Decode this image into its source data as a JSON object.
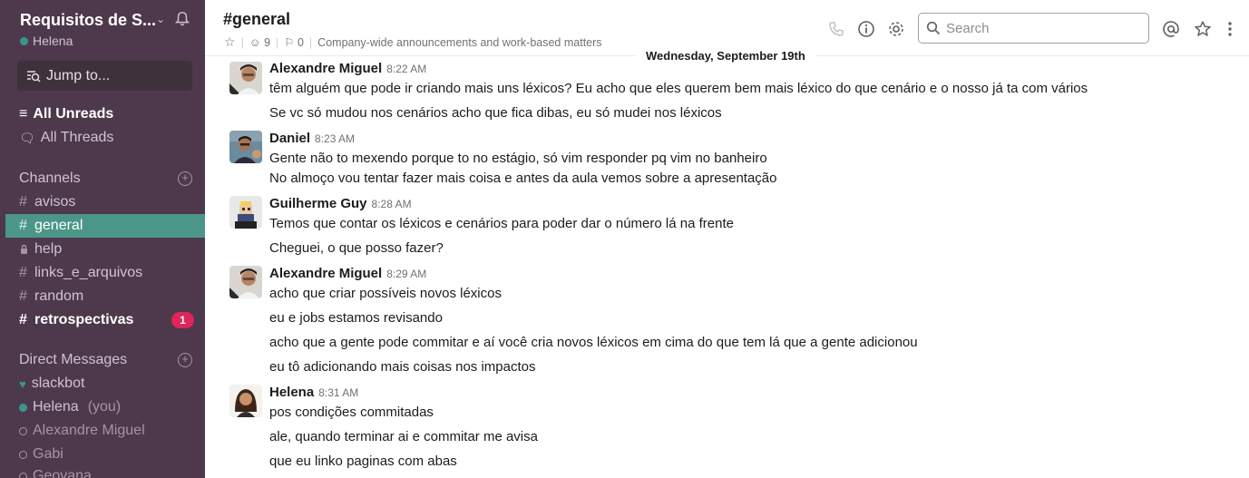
{
  "sidebar": {
    "workspace_name": "Requisitos de S...",
    "user_name": "Helena",
    "jump_to": "Jump to...",
    "all_unreads": "All Unreads",
    "all_threads": "All Threads",
    "channels_header": "Channels",
    "channels": [
      {
        "name": "avisos"
      },
      {
        "name": "general"
      },
      {
        "name": "help"
      },
      {
        "name": "links_e_arquivos"
      },
      {
        "name": "random"
      },
      {
        "name": "retrospectivas",
        "badge": "1"
      }
    ],
    "dm_header": "Direct Messages",
    "dms": [
      {
        "name": "slackbot"
      },
      {
        "name": "Helena",
        "suffix": "(you)"
      },
      {
        "name": "Alexandre Miguel"
      },
      {
        "name": "Gabi"
      },
      {
        "name": "Geovana"
      }
    ]
  },
  "header": {
    "channel_title": "#general",
    "members_count": "9",
    "pinned_count": "0",
    "topic": "Company-wide announcements and work-based matters",
    "search_placeholder": "Search"
  },
  "date_divider": "Wednesday, September 19th",
  "messages": [
    {
      "author": "Alexandre Miguel",
      "time": "8:22 AM",
      "lines": [
        "têm alguém que pode ir criando mais uns léxicos? Eu acho que eles querem bem mais léxico do que cenário e o nosso já ta com vários",
        "Se vc só mudou nos cenários acho que fica dibas, eu só mudei nos léxicos"
      ]
    },
    {
      "author": "Daniel",
      "time": "8:23 AM",
      "lines": [
        "Gente não to mexendo porque to no estágio, só vim responder pq vim no banheiro",
        "No almoço vou tentar fazer mais coisa e antes da aula vemos sobre a apresentação"
      ]
    },
    {
      "author": "Guilherme Guy",
      "time": "8:28 AM",
      "lines": [
        "Temos que contar os léxicos e cenários para poder dar o número lá na frente",
        "Cheguei, o que posso fazer?"
      ]
    },
    {
      "author": "Alexandre Miguel",
      "time": "8:29 AM",
      "lines": [
        "acho que criar possíveis novos léxicos",
        "eu e jobs estamos revisando",
        "acho que a gente pode commitar e aí você cria novos léxicos em cima do que tem lá que a gente adicionou",
        "eu tô adicionando mais coisas nos impactos"
      ]
    },
    {
      "author": "Helena",
      "time": "8:31 AM",
      "lines": [
        "pos condições commitadas",
        "ale, quando terminar ai e commitar me avisa",
        "que eu linko paginas com abas"
      ]
    }
  ]
}
